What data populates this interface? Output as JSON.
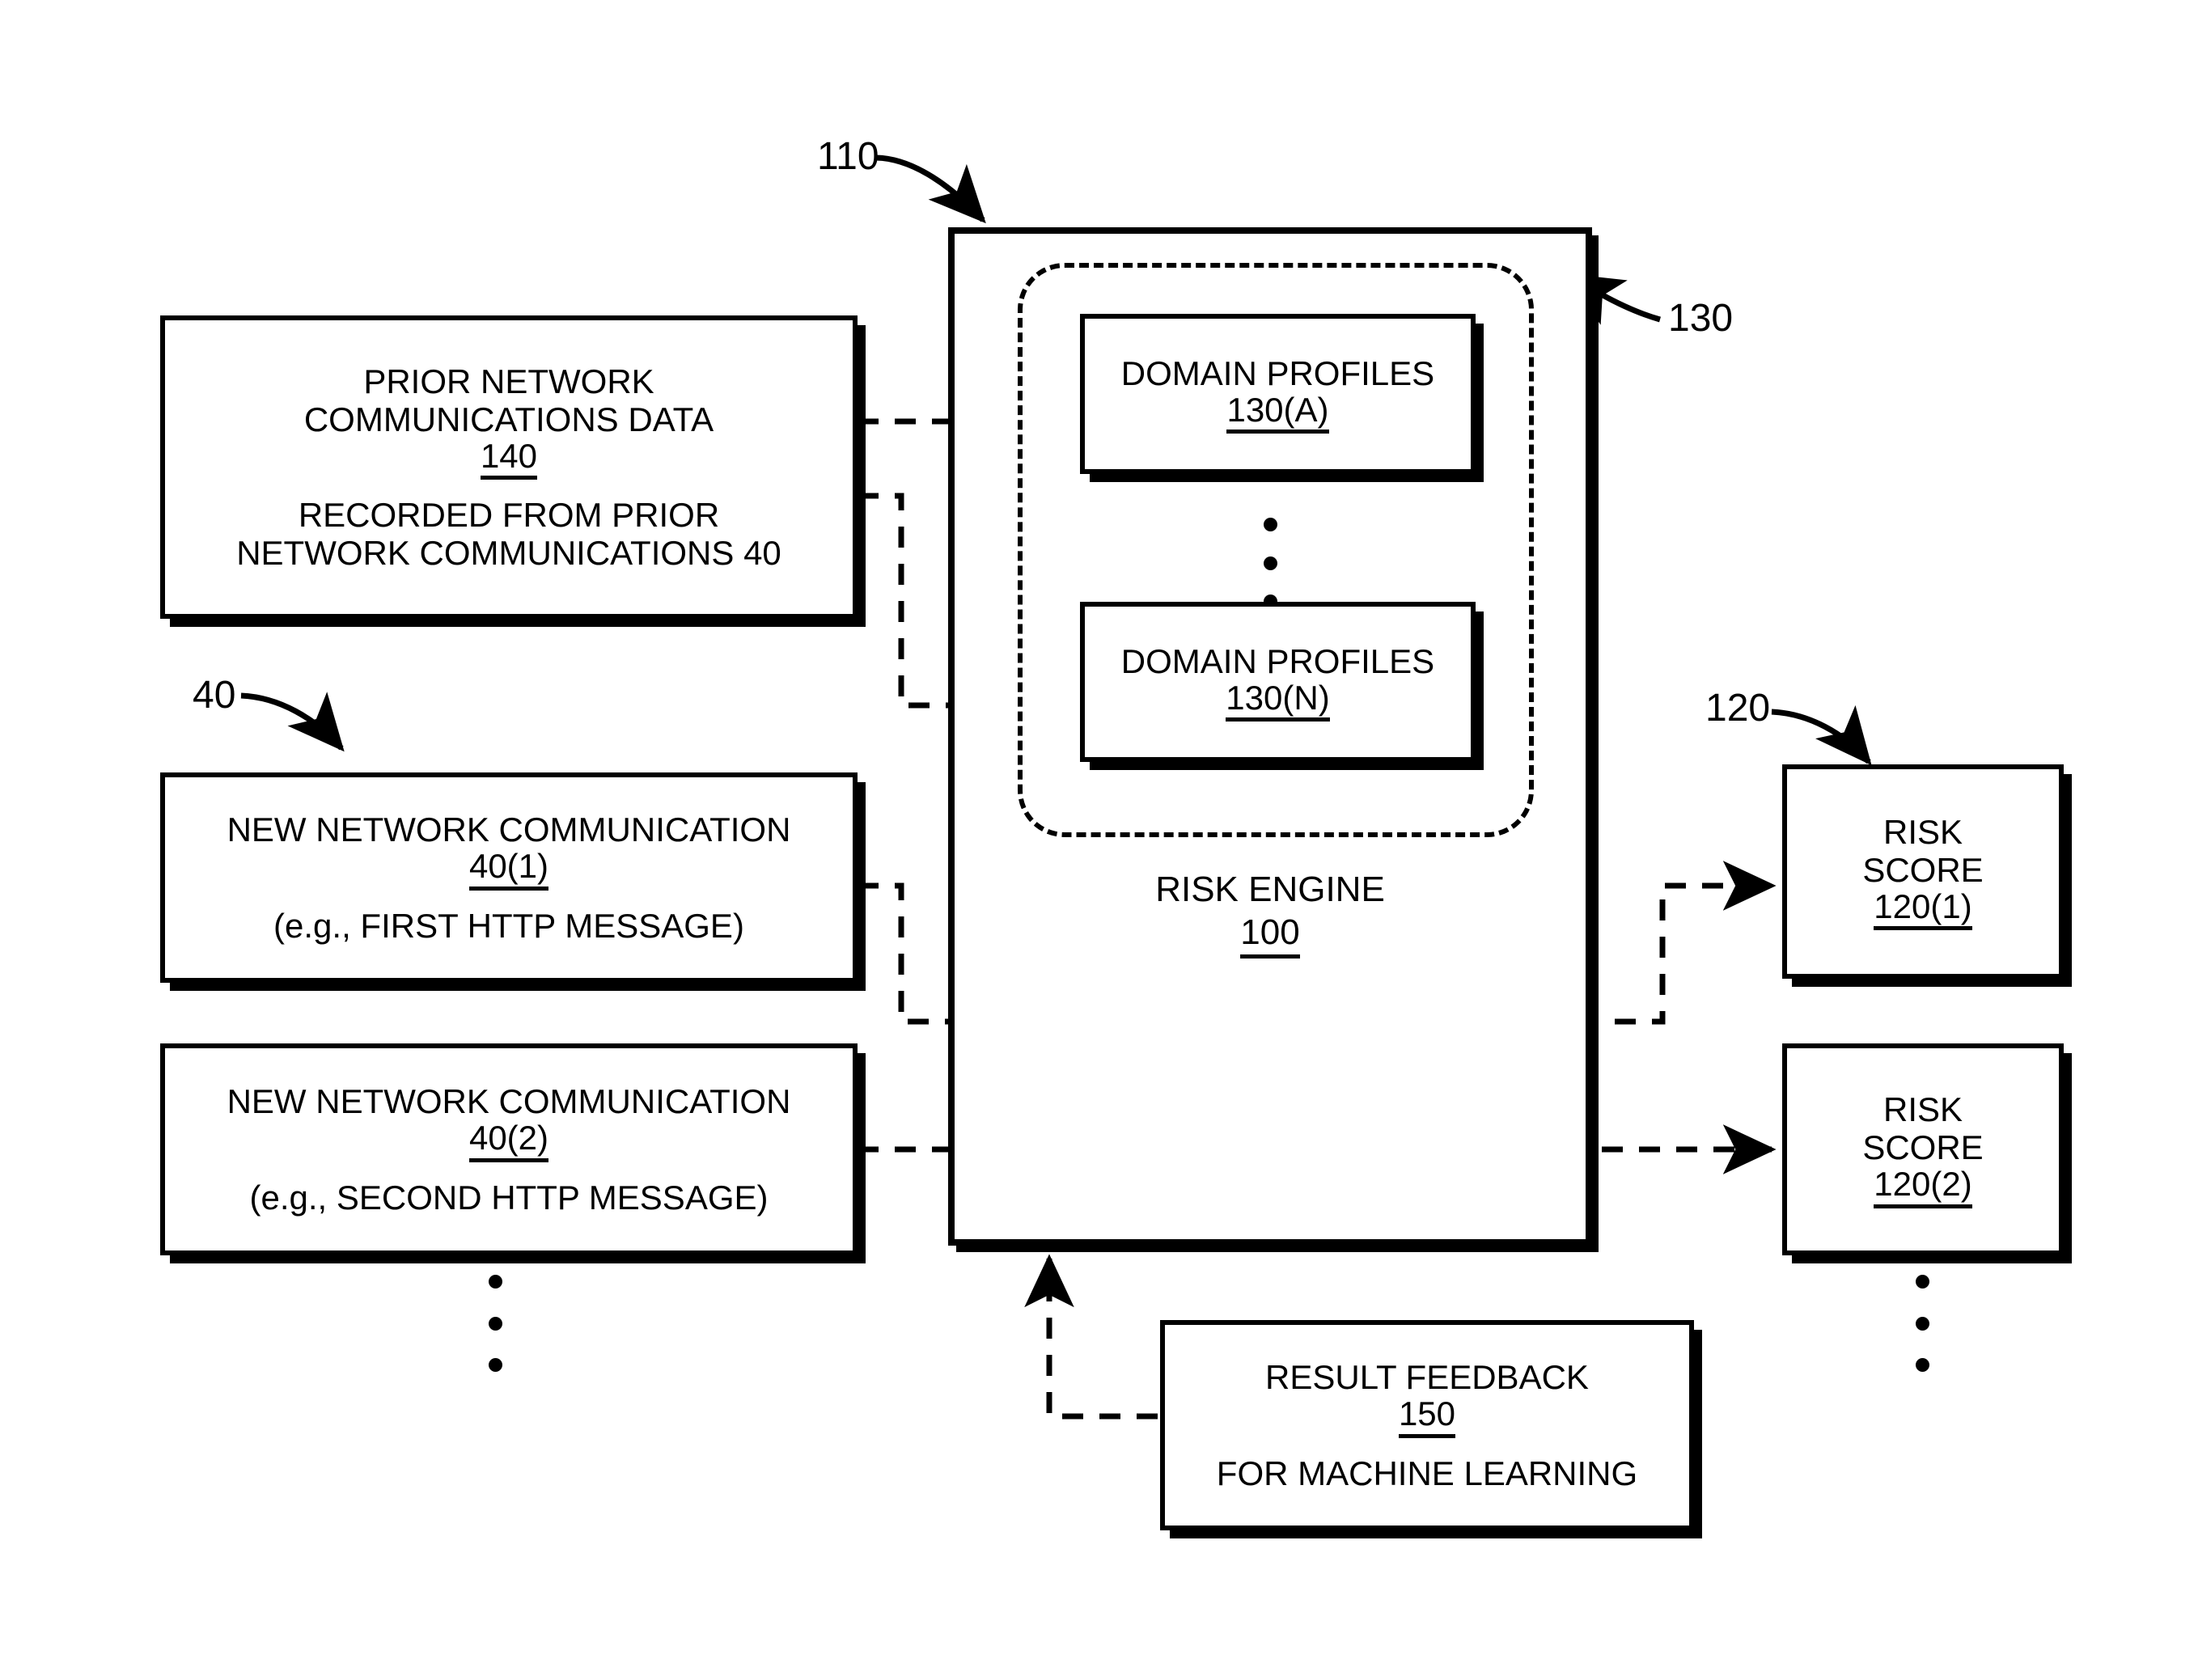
{
  "figure": {
    "title": "Risk engine block diagram",
    "ink_color": "#000000",
    "background_color": "#ffffff"
  },
  "ref_numerals": {
    "system_110": "110",
    "domain_profiles_group_130": "130",
    "new_comms_40": "40",
    "risk_scores_120": "120"
  },
  "boxes": {
    "prior_data": {
      "line1": "PRIOR NETWORK",
      "line2": "COMMUNICATIONS DATA",
      "number": "140",
      "line3": "RECORDED FROM PRIOR",
      "line4": "NETWORK COMMUNICATIONS 40"
    },
    "new_comm_1": {
      "line1": "NEW NETWORK COMMUNICATION",
      "number": "40(1)",
      "line2": "(e.g., FIRST HTTP MESSAGE)"
    },
    "new_comm_2": {
      "line1": "NEW NETWORK COMMUNICATION",
      "number": "40(2)",
      "line2": "(e.g., SECOND HTTP MESSAGE)"
    },
    "domain_profiles_a": {
      "line1": "DOMAIN PROFILES",
      "number": "130(A)"
    },
    "domain_profiles_n": {
      "line1": "DOMAIN PROFILES",
      "number": "130(N)"
    },
    "risk_engine": {
      "line1": "RISK ENGINE",
      "number": "100"
    },
    "risk_score_1": {
      "line1": "RISK",
      "line2": "SCORE",
      "number": "120(1)"
    },
    "risk_score_2": {
      "line1": "RISK",
      "line2": "SCORE",
      "number": "120(2)"
    },
    "result_feedback": {
      "line1": "RESULT FEEDBACK",
      "number": "150",
      "line2": "FOR MACHINE LEARNING"
    }
  }
}
